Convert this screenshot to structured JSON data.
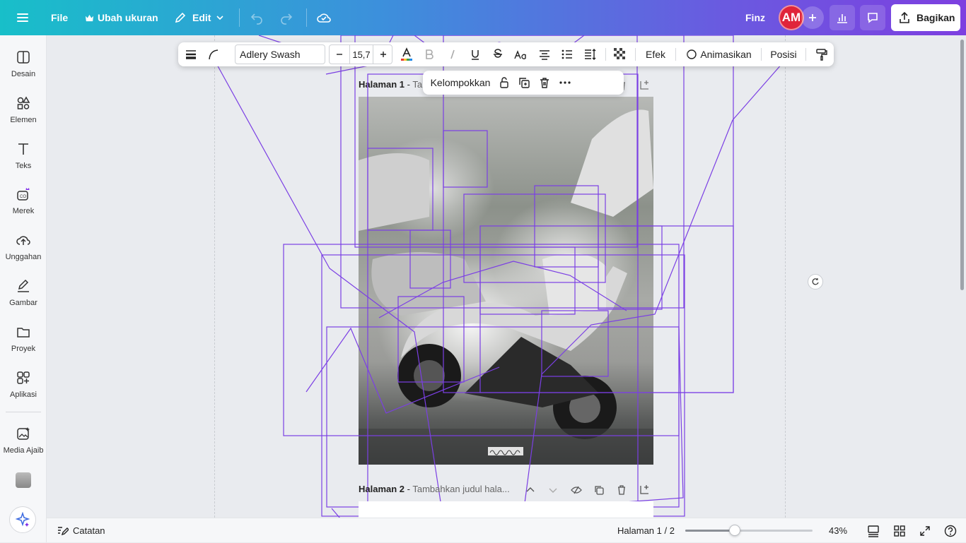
{
  "topbar": {
    "file_label": "File",
    "resize_label": "Ubah ukuran",
    "edit_label": "Edit",
    "user_name": "Finz",
    "avatar_initials": "AM",
    "share_label": "Bagikan",
    "avatar_color": "#e0243a"
  },
  "sidebar": {
    "items": [
      {
        "label": "Desain",
        "icon": "layout-icon"
      },
      {
        "label": "Elemen",
        "icon": "shapes-icon"
      },
      {
        "label": "Teks",
        "icon": "text-icon"
      },
      {
        "label": "Merek",
        "icon": "brand-icon"
      },
      {
        "label": "Unggahan",
        "icon": "upload-cloud-icon"
      },
      {
        "label": "Gambar",
        "icon": "draw-icon"
      },
      {
        "label": "Proyek",
        "icon": "folder-icon"
      },
      {
        "label": "Aplikasi",
        "icon": "apps-icon"
      },
      {
        "label": "Media Ajaib",
        "icon": "magic-media-icon"
      }
    ]
  },
  "toolbar": {
    "font_name": "Adlery Swash",
    "font_size": "15,7",
    "effects_label": "Efek",
    "animate_label": "Animasikan",
    "position_label": "Posisi"
  },
  "selection": {
    "group_label": "Kelompokkan"
  },
  "pages": [
    {
      "label": "Halaman 1",
      "subtitle": "Tam"
    },
    {
      "label": "Halaman 2",
      "subtitle": "Tambahkan judul hala..."
    }
  ],
  "bottombar": {
    "notes_label": "Catatan",
    "page_indicator": "Halaman 1 / 2",
    "zoom_label": "43%",
    "zoom_fraction": 0.39
  },
  "colors": {
    "selection_outline": "#7b3fe4",
    "accent": "#7d2ae8"
  }
}
